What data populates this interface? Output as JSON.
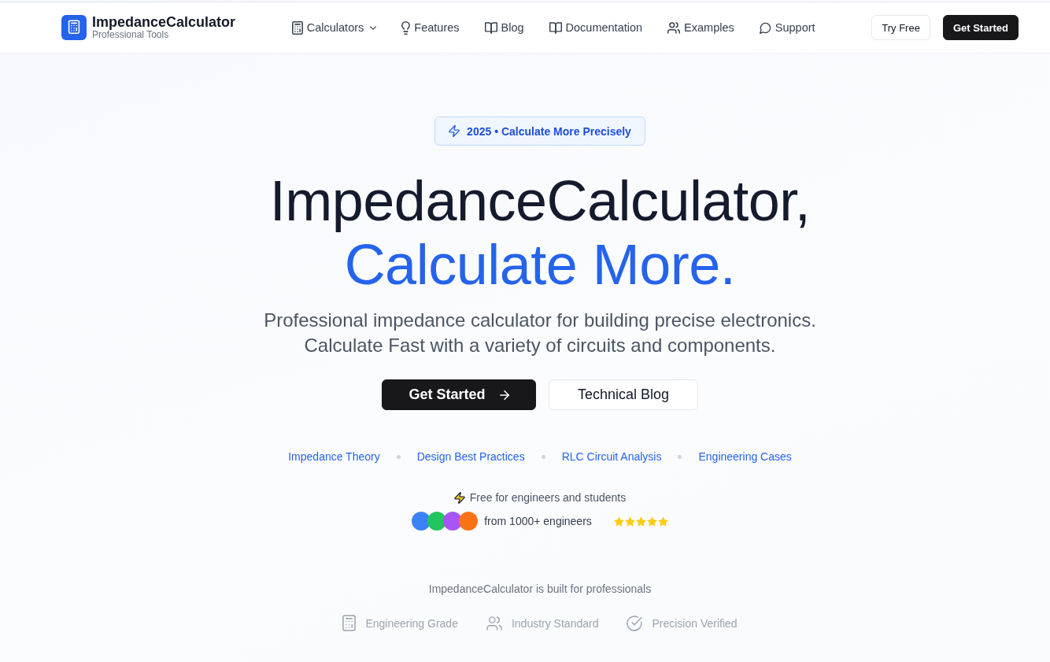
{
  "header": {
    "brand": {
      "name": "ImpedanceCalculator",
      "tagline": "Professional Tools"
    },
    "nav": [
      {
        "label": "Calculators",
        "has_menu": true
      },
      {
        "label": "Features",
        "has_menu": false
      },
      {
        "label": "Blog",
        "has_menu": false
      },
      {
        "label": "Documentation",
        "has_menu": false
      },
      {
        "label": "Examples",
        "has_menu": false
      },
      {
        "label": "Support",
        "has_menu": false
      }
    ],
    "actions": [
      {
        "label": "Try Free",
        "kind": "outline"
      },
      {
        "label": "Get Started",
        "kind": "solid"
      }
    ]
  },
  "hero": {
    "badge": "2025 • Calculate More Precisely",
    "title": "ImpedanceCalculator,",
    "title_highlight": "Calculate More.",
    "subtitle_lines": [
      "Professional impedance calculator for building precise electronics.",
      "Calculate Fast with a variety of circuits and components."
    ],
    "buttons": [
      {
        "label": "Get Started",
        "kind": "primary"
      },
      {
        "label": "Technical Blog",
        "kind": "secondary"
      }
    ],
    "topics": [
      "Impedance Theory",
      "Design Best Practices",
      "RLC Circuit Analysis",
      "Engineering Cases"
    ],
    "free_note": "Free for engineers and students",
    "avatars": [
      {
        "color": "#3b82f6"
      },
      {
        "color": "#22c55e"
      },
      {
        "color": "#a855f7"
      },
      {
        "color": "#f97316"
      }
    ],
    "social_proof": "from 1000+ engineers",
    "stars": 5
  },
  "trust": {
    "heading": "ImpedanceCalculator is built for professionals",
    "items": [
      "Engineering Grade",
      "Industry Standard",
      "Precision Verified"
    ]
  }
}
